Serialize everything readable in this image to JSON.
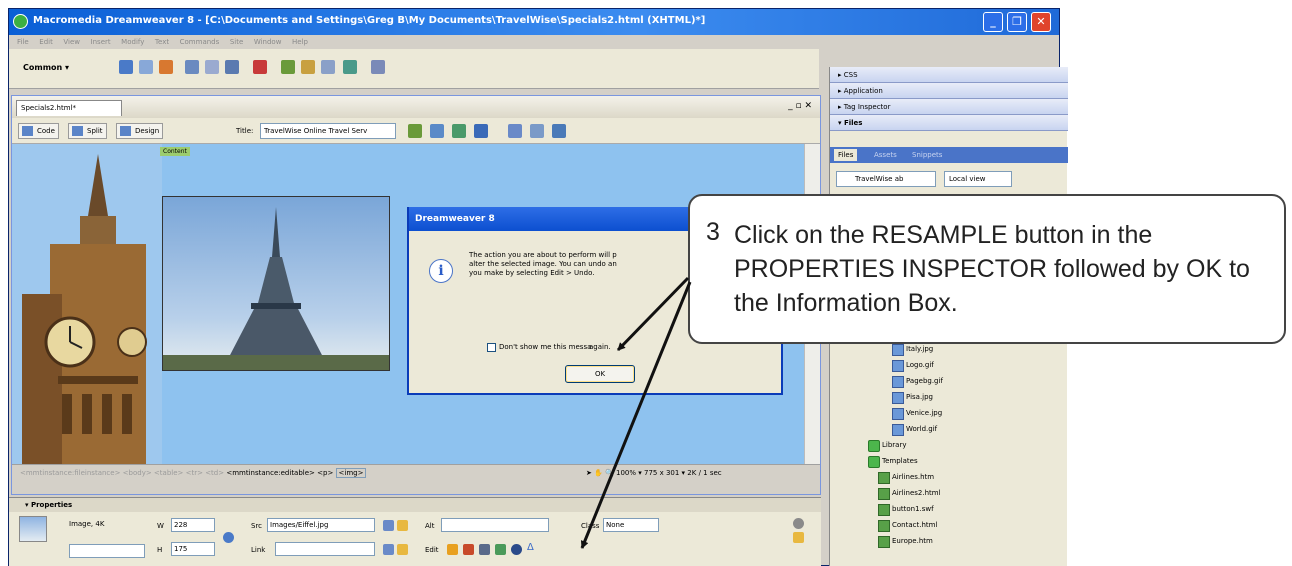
{
  "window": {
    "title": "Macromedia Dreamweaver 8 - [C:\\Documents and Settings\\Greg B\\My Documents\\TravelWise\\Specials2.html (XHTML)*]"
  },
  "menubar": [
    "File",
    "Edit",
    "View",
    "Insert",
    "Modify",
    "Text",
    "Commands",
    "Site",
    "Window",
    "Help"
  ],
  "insertbar": {
    "category": "Common"
  },
  "document": {
    "tab": "Specials2.html*",
    "toolbar": {
      "code": "Code",
      "split": "Split",
      "design": "Design",
      "title_label": "Title:",
      "title_value": "TravelWise Online Travel Serv"
    },
    "content_label": "Content",
    "tag_selector": {
      "faded": "<mmtinstance:fileinstance> <body> <table> <tr> <td>",
      "editable": "<mmtinstance:editable> <p>",
      "img": "<img>"
    },
    "status": {
      "zoom": "100%",
      "dimensions": "775 x 301",
      "size": "2K / 1 sec"
    }
  },
  "dialog": {
    "title": "Dreamweaver 8",
    "message_lines": [
      "The action you are about to perform will p",
      "alter the selected image. You can undo an",
      "you make by selecting Edit > Undo."
    ],
    "checkbox_label": "Don't show me this messa",
    "checkbox_label_tail": "again.",
    "ok_label": "OK"
  },
  "properties": {
    "header": "Properties",
    "type": "Image, 4K",
    "w_label": "W",
    "w_value": "228",
    "h_label": "H",
    "h_value": "175",
    "src_label": "Src",
    "src_value": "Images/Eiffel.jpg",
    "alt_label": "Alt",
    "link_label": "Link",
    "edit_label": "Edit",
    "class_label": "Class",
    "class_value": "None"
  },
  "panels": {
    "css": "▸ CSS",
    "application": "▸ Application",
    "tag_inspector": "▸ Tag Inspector",
    "files": "▾ Files",
    "tabs": [
      "Files",
      "Assets",
      "Snippets"
    ],
    "site": "TravelWise ab",
    "view": "Local view",
    "tree": [
      {
        "name": "Italy.jpg",
        "kind": "file",
        "indent": 1
      },
      {
        "name": "Logo.gif",
        "kind": "file",
        "indent": 1
      },
      {
        "name": "Pagebg.gif",
        "kind": "file",
        "indent": 1
      },
      {
        "name": "Pisa.jpg",
        "kind": "file",
        "indent": 1
      },
      {
        "name": "Venice.jpg",
        "kind": "file",
        "indent": 1
      },
      {
        "name": "World.gif",
        "kind": "file",
        "indent": 1
      },
      {
        "name": "Library",
        "kind": "folder",
        "indent": 0
      },
      {
        "name": "Templates",
        "kind": "folder",
        "indent": 0
      },
      {
        "name": "Airlines.htm",
        "kind": "check",
        "indent": 0
      },
      {
        "name": "Airlines2.html",
        "kind": "check",
        "indent": 0
      },
      {
        "name": "button1.swf",
        "kind": "check",
        "indent": 0
      },
      {
        "name": "Contact.html",
        "kind": "check",
        "indent": 0
      },
      {
        "name": "Europe.htm",
        "kind": "check",
        "indent": 0
      }
    ]
  },
  "callout": {
    "number": "3",
    "text": "Click on the RESAMPLE button in the PROPERTIES INSPECTOR followed by OK to the Information Box."
  },
  "colors": {
    "xp_title_blue": "#0a5fd6",
    "canvas_blue": "#8ec2ef",
    "panel_bg": "#ece9d8"
  }
}
